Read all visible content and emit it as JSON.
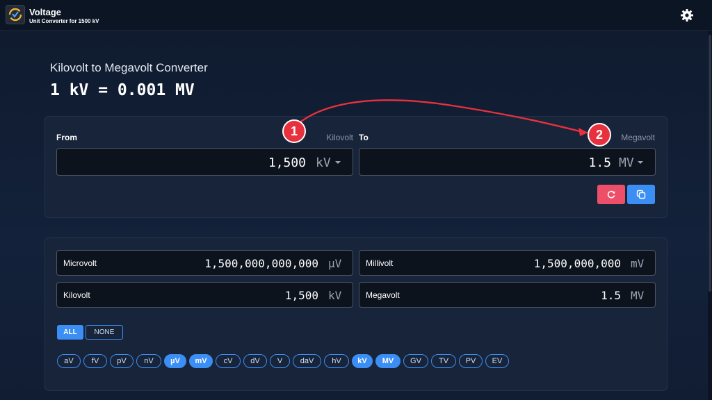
{
  "app": {
    "title": "Voltage",
    "subtitle": "Unit Converter for 1500 kV"
  },
  "page": {
    "heading": "Kilovolt to Megavolt Converter",
    "formula": "1 kV = 0.001 MV"
  },
  "converter": {
    "from": {
      "label": "From",
      "unit_name": "Kilovolt",
      "value": "1,500",
      "unit": "kV"
    },
    "to": {
      "label": "To",
      "unit_name": "Megavolt",
      "value": "1.5",
      "unit": "MV"
    }
  },
  "results": [
    {
      "label": "Microvolt",
      "value": "1,500,000,000,000",
      "unit": "µV"
    },
    {
      "label": "Millivolt",
      "value": "1,500,000,000",
      "unit": "mV"
    },
    {
      "label": "Kilovolt",
      "value": "1,500",
      "unit": "kV"
    },
    {
      "label": "Megavolt",
      "value": "1.5",
      "unit": "MV"
    }
  ],
  "filters": {
    "all_label": "ALL",
    "none_label": "NONE",
    "units": [
      {
        "label": "aV",
        "selected": false
      },
      {
        "label": "fV",
        "selected": false
      },
      {
        "label": "pV",
        "selected": false
      },
      {
        "label": "nV",
        "selected": false
      },
      {
        "label": "µV",
        "selected": true
      },
      {
        "label": "mV",
        "selected": true
      },
      {
        "label": "cV",
        "selected": false
      },
      {
        "label": "dV",
        "selected": false
      },
      {
        "label": "V",
        "selected": false
      },
      {
        "label": "daV",
        "selected": false
      },
      {
        "label": "hV",
        "selected": false
      },
      {
        "label": "kV",
        "selected": true
      },
      {
        "label": "MV",
        "selected": true
      },
      {
        "label": "GV",
        "selected": false
      },
      {
        "label": "TV",
        "selected": false
      },
      {
        "label": "PV",
        "selected": false
      },
      {
        "label": "EV",
        "selected": false
      }
    ]
  },
  "annotations": [
    {
      "label": "1"
    },
    {
      "label": "2"
    }
  ],
  "colors": {
    "accent": "#3b8ef3",
    "reset": "#ee4f68",
    "annotation": "#e8313e"
  },
  "icons": [
    "app-logo-icon",
    "gear-icon",
    "refresh-icon",
    "copy-icon",
    "chevron-down-icon"
  ]
}
